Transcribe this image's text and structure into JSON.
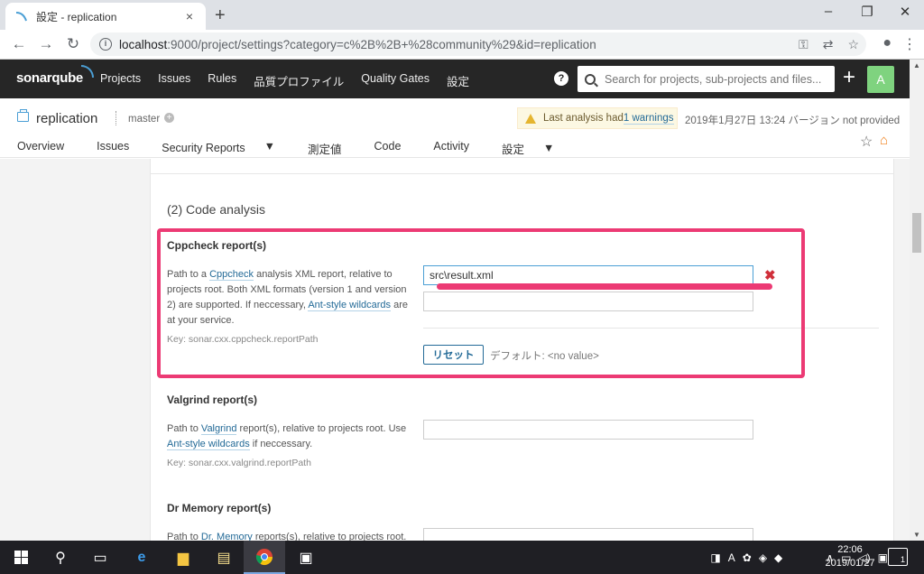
{
  "browser": {
    "tab_title": "設定 - replication",
    "tab_close": "×",
    "new_tab": "+",
    "url_host": "localhost",
    "url_rest": ":9000/project/settings?category=c%2B%2B+%28community%29&id=replication",
    "window_controls": [
      "–",
      "❐",
      "✕"
    ]
  },
  "sonar": {
    "logo": "sonarqube",
    "nav": [
      "Projects",
      "Issues",
      "Rules",
      "品質プロファイル",
      "Quality Gates",
      "設定"
    ],
    "search_placeholder": "Search for projects, sub-projects and files...",
    "avatar_letter": "A",
    "help": "?"
  },
  "project": {
    "name": "replication",
    "branch": "master",
    "warning_text": "Last analysis had ",
    "warning_link": "1 warnings",
    "analysis_meta": "2019年1月27日 13:24  バージョン not provided",
    "tabs": [
      {
        "label": "Overview"
      },
      {
        "label": "Issues"
      },
      {
        "label": "Security Reports",
        "caret": true
      },
      {
        "label": "測定値"
      },
      {
        "label": "Code"
      },
      {
        "label": "Activity"
      },
      {
        "label": "設定",
        "caret": true,
        "active": true
      }
    ]
  },
  "settings": {
    "section_title": "(2) Code analysis",
    "cppcheck": {
      "title": "Cppcheck report(s)",
      "desc_1": "Path to a ",
      "desc_link_1": "Cppcheck",
      "desc_2": " analysis XML report, relative to projects root. Both XML formats (version 1 and version 2) are supported. If neccessary, ",
      "desc_link_2": "Ant-style wildcards",
      "desc_3": " are at your service.",
      "key": "Key: sonar.cxx.cppcheck.reportPath",
      "value": "src\\result.xml",
      "value2": "",
      "reset_label": "リセット",
      "default_label": "デフォルト: <no value>",
      "delete": "✖"
    },
    "valgrind": {
      "title": "Valgrind report(s)",
      "desc_1": "Path to ",
      "desc_link_1": "Valgrind",
      "desc_2": " report(s), relative to projects root. Use ",
      "desc_link_2": "Ant-style wildcards",
      "desc_3": " if neccessary.",
      "key": "Key: sonar.cxx.valgrind.reportPath",
      "value": ""
    },
    "drmemory": {
      "title": "Dr Memory report(s)",
      "desc_1": "Path to ",
      "desc_link_1": "Dr. Memory",
      "desc_2": " reports(s), relative to projects root.",
      "value": ""
    }
  },
  "taskbar": {
    "clock_time": "22:06",
    "clock_date": "2019/01/27",
    "notification_count": "1",
    "tray_letter": "A"
  },
  "colors": {
    "highlight": "#ec3a74",
    "sonar_nav": "#262626",
    "link": "#236a97"
  }
}
